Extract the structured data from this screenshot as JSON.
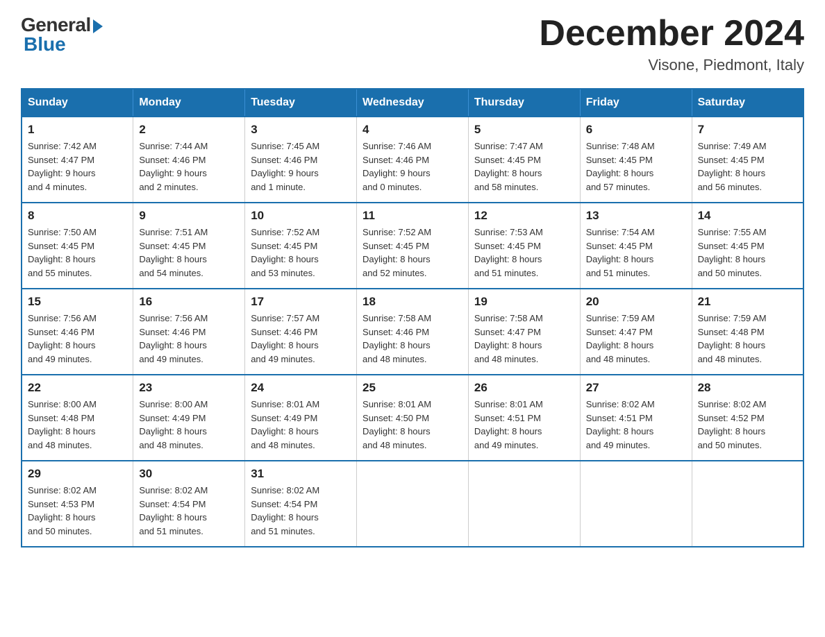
{
  "logo": {
    "general": "General",
    "blue": "Blue"
  },
  "title": "December 2024",
  "location": "Visone, Piedmont, Italy",
  "days_of_week": [
    "Sunday",
    "Monday",
    "Tuesday",
    "Wednesday",
    "Thursday",
    "Friday",
    "Saturday"
  ],
  "weeks": [
    [
      {
        "day": "1",
        "info": "Sunrise: 7:42 AM\nSunset: 4:47 PM\nDaylight: 9 hours\nand 4 minutes."
      },
      {
        "day": "2",
        "info": "Sunrise: 7:44 AM\nSunset: 4:46 PM\nDaylight: 9 hours\nand 2 minutes."
      },
      {
        "day": "3",
        "info": "Sunrise: 7:45 AM\nSunset: 4:46 PM\nDaylight: 9 hours\nand 1 minute."
      },
      {
        "day": "4",
        "info": "Sunrise: 7:46 AM\nSunset: 4:46 PM\nDaylight: 9 hours\nand 0 minutes."
      },
      {
        "day": "5",
        "info": "Sunrise: 7:47 AM\nSunset: 4:45 PM\nDaylight: 8 hours\nand 58 minutes."
      },
      {
        "day": "6",
        "info": "Sunrise: 7:48 AM\nSunset: 4:45 PM\nDaylight: 8 hours\nand 57 minutes."
      },
      {
        "day": "7",
        "info": "Sunrise: 7:49 AM\nSunset: 4:45 PM\nDaylight: 8 hours\nand 56 minutes."
      }
    ],
    [
      {
        "day": "8",
        "info": "Sunrise: 7:50 AM\nSunset: 4:45 PM\nDaylight: 8 hours\nand 55 minutes."
      },
      {
        "day": "9",
        "info": "Sunrise: 7:51 AM\nSunset: 4:45 PM\nDaylight: 8 hours\nand 54 minutes."
      },
      {
        "day": "10",
        "info": "Sunrise: 7:52 AM\nSunset: 4:45 PM\nDaylight: 8 hours\nand 53 minutes."
      },
      {
        "day": "11",
        "info": "Sunrise: 7:52 AM\nSunset: 4:45 PM\nDaylight: 8 hours\nand 52 minutes."
      },
      {
        "day": "12",
        "info": "Sunrise: 7:53 AM\nSunset: 4:45 PM\nDaylight: 8 hours\nand 51 minutes."
      },
      {
        "day": "13",
        "info": "Sunrise: 7:54 AM\nSunset: 4:45 PM\nDaylight: 8 hours\nand 51 minutes."
      },
      {
        "day": "14",
        "info": "Sunrise: 7:55 AM\nSunset: 4:45 PM\nDaylight: 8 hours\nand 50 minutes."
      }
    ],
    [
      {
        "day": "15",
        "info": "Sunrise: 7:56 AM\nSunset: 4:46 PM\nDaylight: 8 hours\nand 49 minutes."
      },
      {
        "day": "16",
        "info": "Sunrise: 7:56 AM\nSunset: 4:46 PM\nDaylight: 8 hours\nand 49 minutes."
      },
      {
        "day": "17",
        "info": "Sunrise: 7:57 AM\nSunset: 4:46 PM\nDaylight: 8 hours\nand 49 minutes."
      },
      {
        "day": "18",
        "info": "Sunrise: 7:58 AM\nSunset: 4:46 PM\nDaylight: 8 hours\nand 48 minutes."
      },
      {
        "day": "19",
        "info": "Sunrise: 7:58 AM\nSunset: 4:47 PM\nDaylight: 8 hours\nand 48 minutes."
      },
      {
        "day": "20",
        "info": "Sunrise: 7:59 AM\nSunset: 4:47 PM\nDaylight: 8 hours\nand 48 minutes."
      },
      {
        "day": "21",
        "info": "Sunrise: 7:59 AM\nSunset: 4:48 PM\nDaylight: 8 hours\nand 48 minutes."
      }
    ],
    [
      {
        "day": "22",
        "info": "Sunrise: 8:00 AM\nSunset: 4:48 PM\nDaylight: 8 hours\nand 48 minutes."
      },
      {
        "day": "23",
        "info": "Sunrise: 8:00 AM\nSunset: 4:49 PM\nDaylight: 8 hours\nand 48 minutes."
      },
      {
        "day": "24",
        "info": "Sunrise: 8:01 AM\nSunset: 4:49 PM\nDaylight: 8 hours\nand 48 minutes."
      },
      {
        "day": "25",
        "info": "Sunrise: 8:01 AM\nSunset: 4:50 PM\nDaylight: 8 hours\nand 48 minutes."
      },
      {
        "day": "26",
        "info": "Sunrise: 8:01 AM\nSunset: 4:51 PM\nDaylight: 8 hours\nand 49 minutes."
      },
      {
        "day": "27",
        "info": "Sunrise: 8:02 AM\nSunset: 4:51 PM\nDaylight: 8 hours\nand 49 minutes."
      },
      {
        "day": "28",
        "info": "Sunrise: 8:02 AM\nSunset: 4:52 PM\nDaylight: 8 hours\nand 50 minutes."
      }
    ],
    [
      {
        "day": "29",
        "info": "Sunrise: 8:02 AM\nSunset: 4:53 PM\nDaylight: 8 hours\nand 50 minutes."
      },
      {
        "day": "30",
        "info": "Sunrise: 8:02 AM\nSunset: 4:54 PM\nDaylight: 8 hours\nand 51 minutes."
      },
      {
        "day": "31",
        "info": "Sunrise: 8:02 AM\nSunset: 4:54 PM\nDaylight: 8 hours\nand 51 minutes."
      },
      null,
      null,
      null,
      null
    ]
  ]
}
